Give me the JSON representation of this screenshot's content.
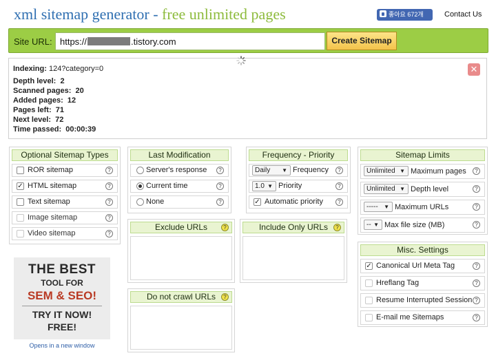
{
  "header": {
    "title_part1": "xml sitemap generator",
    "title_sep": " - ",
    "title_part2": "free unlimited pages",
    "fb_like": "좋아요 672개",
    "contact_link": "Contact Us"
  },
  "urlbar": {
    "label": "Site URL:",
    "value_prefix": "https://",
    "value_suffix": ".tistory.com",
    "button": "Create Sitemap"
  },
  "indexing": {
    "label": "Indexing:",
    "value": "124?category=0",
    "stats": [
      {
        "label": "Depth level:",
        "value": "2"
      },
      {
        "label": "Scanned pages:",
        "value": "20"
      },
      {
        "label": "Added pages:",
        "value": "12"
      },
      {
        "label": "Pages left:",
        "value": "71"
      },
      {
        "label": "Next level:",
        "value": "72"
      },
      {
        "label": "Time passed:",
        "value": "00:00:39"
      }
    ]
  },
  "sitemap_types": {
    "title": "Optional Sitemap Types",
    "items": [
      {
        "label": "ROR sitemap",
        "checked": false
      },
      {
        "label": "HTML sitemap",
        "checked": true
      },
      {
        "label": "Text sitemap",
        "checked": false
      },
      {
        "label": "Image sitemap",
        "checked": false
      },
      {
        "label": "Video sitemap",
        "checked": false
      }
    ]
  },
  "last_mod": {
    "title": "Last Modification",
    "items": [
      {
        "label": "Server's response",
        "selected": false
      },
      {
        "label": "Current time",
        "selected": true
      },
      {
        "label": "None",
        "selected": false
      }
    ]
  },
  "frequency": {
    "title": "Frequency - Priority",
    "freq_value": "Daily",
    "freq_label": "Frequency",
    "prio_value": "1.0",
    "prio_label": "Priority",
    "auto_label": "Automatic priority"
  },
  "limits": {
    "title": "Sitemap Limits",
    "max_pages_value": "Unlimited",
    "max_pages_label": "Maximum pages",
    "depth_value": "Unlimited",
    "depth_label": "Depth level",
    "max_urls_value": "-----",
    "max_urls_label": "Maximum URLs",
    "max_size_value": "--",
    "max_size_label": "Max file size (MB)"
  },
  "misc": {
    "title": "Misc. Settings",
    "items": [
      {
        "label": "Canonical Url Meta Tag",
        "checked": true
      },
      {
        "label": "Hreflang Tag",
        "checked": false
      },
      {
        "label": "Resume Interrupted Session",
        "checked": false
      },
      {
        "label": "E-mail me Sitemaps",
        "checked": false
      }
    ]
  },
  "exclude_urls": {
    "title": "Exclude URLs"
  },
  "include_urls": {
    "title": "Include Only URLs"
  },
  "no_crawl": {
    "title": "Do not crawl URLs"
  },
  "ad": {
    "line1": "THE BEST",
    "line2": "TOOL FOR",
    "line3": "SEM & SEO!",
    "line4": "TRY IT NOW!",
    "line5": "FREE!",
    "note": "Opens in a new window"
  },
  "icons": {
    "help": "?",
    "check": "✓",
    "close": "✕",
    "dropdown": "▼"
  }
}
